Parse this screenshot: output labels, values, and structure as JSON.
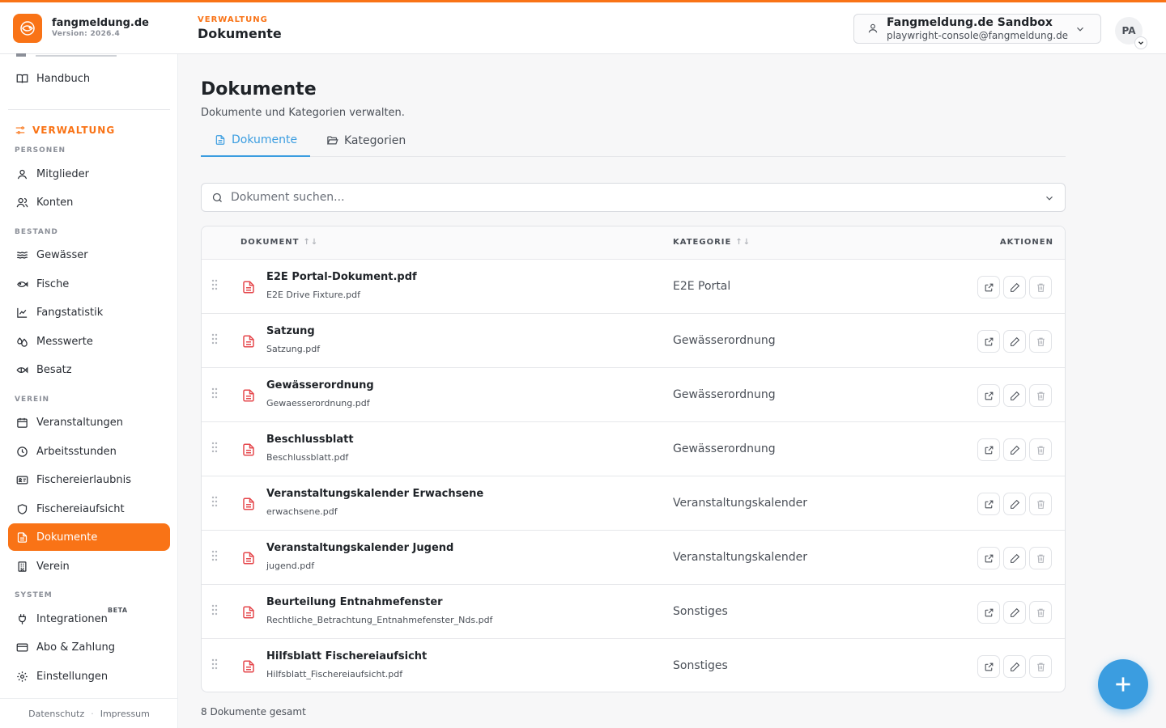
{
  "app": {
    "name": "fangmeldung.de",
    "version": "Version: 2026.4",
    "accent": "#f97316"
  },
  "header": {
    "section": "VERWALTUNG",
    "title": "Dokumente",
    "tenant_name": "Fangmeldung.de Sandbox",
    "tenant_email": "playwright-console@fangmeldung.de",
    "avatar_initials": "PA"
  },
  "sidebar": {
    "handbook": "Handbuch",
    "section": "VERWALTUNG",
    "groups": {
      "personen": "PERSONEN",
      "bestand": "BESTAND",
      "verein": "VEREIN",
      "system": "SYSTEM"
    },
    "items": {
      "mitglieder": "Mitglieder",
      "konten": "Konten",
      "gewaesser": "Gewässer",
      "fische": "Fische",
      "fangstatistik": "Fangstatistik",
      "messwerte": "Messwerte",
      "besatz": "Besatz",
      "veranstaltungen": "Veranstaltungen",
      "arbeitsstunden": "Arbeitsstunden",
      "fischereierlaubnis": "Fischereierlaubnis",
      "fischereiaufsicht": "Fischereiaufsicht",
      "dokumente": "Dokumente",
      "verein": "Verein",
      "integrationen": "Integrationen",
      "abo": "Abo & Zahlung",
      "einstellungen": "Einstellungen"
    },
    "beta_badge": "BETA",
    "footer": {
      "datenschutz": "Datenschutz",
      "impressum": "Impressum"
    }
  },
  "main": {
    "title": "Dokumente",
    "subtitle": "Dokumente und Kategorien verwalten.",
    "tabs": {
      "dokumente": "Dokumente",
      "kategorien": "Kategorien"
    },
    "search_placeholder": "Dokument suchen...",
    "columns": {
      "dokument": "DOKUMENT",
      "kategorie": "KATEGORIE",
      "aktionen": "AKTIONEN"
    },
    "rows": [
      {
        "name": "E2E Portal-Dokument.pdf",
        "file": "E2E Drive Fixture.pdf",
        "category": "E2E Portal"
      },
      {
        "name": "Satzung",
        "file": "Satzung.pdf",
        "category": "Gewässerordnung"
      },
      {
        "name": "Gewässerordnung",
        "file": "Gewaesserordnung.pdf",
        "category": "Gewässerordnung"
      },
      {
        "name": "Beschlussblatt",
        "file": "Beschlussblatt.pdf",
        "category": "Gewässerordnung"
      },
      {
        "name": "Veranstaltungskalender Erwachsene",
        "file": "erwachsene.pdf",
        "category": "Veranstaltungskalender"
      },
      {
        "name": "Veranstaltungskalender Jugend",
        "file": "jugend.pdf",
        "category": "Veranstaltungskalender"
      },
      {
        "name": "Beurteilung Entnahmefenster",
        "file": "Rechtliche_Betrachtung_Entnahmefenster_Nds.pdf",
        "category": "Sonstiges"
      },
      {
        "name": "Hilfsblatt Fischereiaufsicht",
        "file": "Hilfsblatt_Fischereiaufsicht.pdf",
        "category": "Sonstiges"
      }
    ],
    "total": "8 Dokumente gesamt"
  }
}
